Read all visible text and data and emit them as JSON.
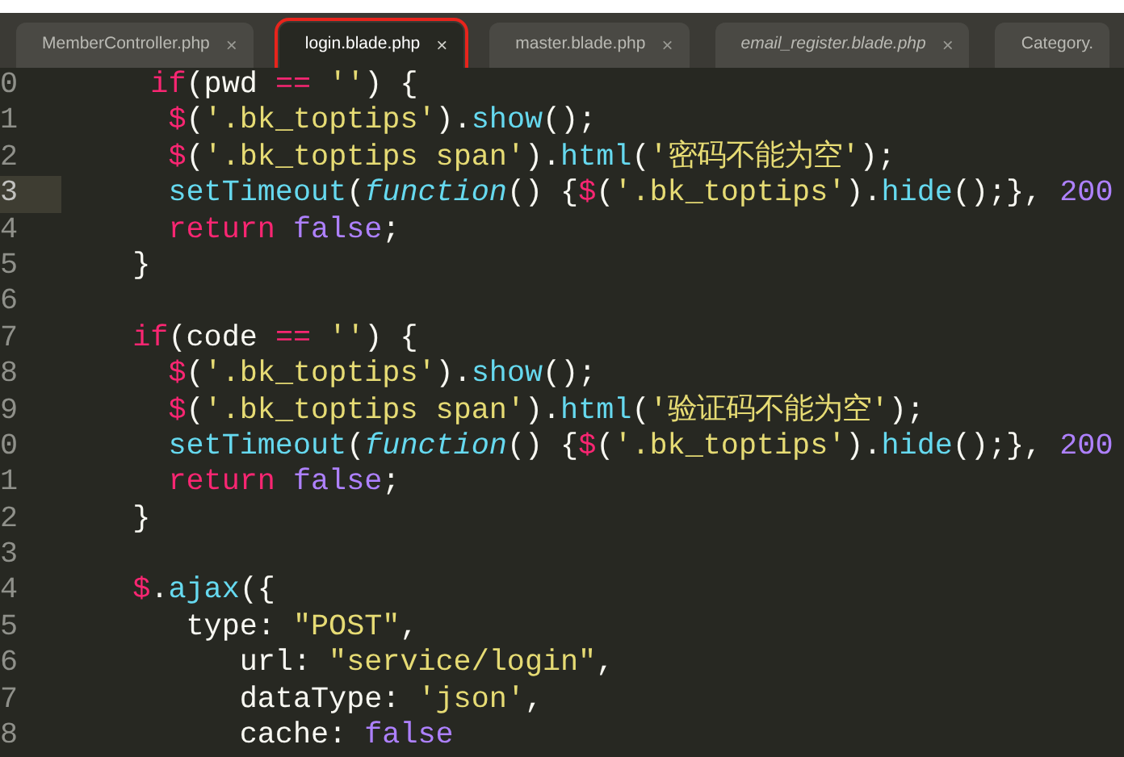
{
  "tabs": [
    {
      "label": "MemberController.php",
      "selected": false,
      "preview": false,
      "outlined": false,
      "closable": true
    },
    {
      "label": "login.blade.php",
      "selected": true,
      "preview": false,
      "outlined": true,
      "closable": true
    },
    {
      "label": "master.blade.php",
      "selected": false,
      "preview": false,
      "outlined": false,
      "closable": true
    },
    {
      "label": "email_register.blade.php",
      "selected": false,
      "preview": true,
      "outlined": false,
      "closable": true
    },
    {
      "label": "Category.",
      "selected": false,
      "preview": false,
      "outlined": false,
      "closable": false
    }
  ],
  "close_glyph": "×",
  "lines": [
    {
      "number": "0",
      "current": false,
      "tokens": [
        {
          "kind": "keyword",
          "text": "     if"
        },
        {
          "kind": "plain",
          "text": "(pwd "
        },
        {
          "kind": "keyword",
          "text": "=="
        },
        {
          "kind": "string",
          "text": " ''"
        },
        {
          "kind": "plain",
          "text": ") {"
        }
      ]
    },
    {
      "number": "1",
      "current": false,
      "tokens": [
        {
          "kind": "keyword",
          "text": "      $"
        },
        {
          "kind": "plain",
          "text": "("
        },
        {
          "kind": "string",
          "text": "'.bk_toptips'"
        },
        {
          "kind": "plain",
          "text": ")."
        },
        {
          "kind": "function",
          "text": "show"
        },
        {
          "kind": "plain",
          "text": "();"
        }
      ]
    },
    {
      "number": "2",
      "current": false,
      "tokens": [
        {
          "kind": "keyword",
          "text": "      $"
        },
        {
          "kind": "plain",
          "text": "("
        },
        {
          "kind": "string",
          "text": "'.bk_toptips span'"
        },
        {
          "kind": "plain",
          "text": ")."
        },
        {
          "kind": "function",
          "text": "html"
        },
        {
          "kind": "plain",
          "text": "("
        },
        {
          "kind": "string",
          "text": "'密码不能为空'"
        },
        {
          "kind": "plain",
          "text": ");"
        }
      ]
    },
    {
      "number": "3",
      "current": true,
      "tokens": [
        {
          "kind": "function",
          "text": "      setTimeout"
        },
        {
          "kind": "plain",
          "text": "("
        },
        {
          "kind": "storage",
          "text": "function"
        },
        {
          "kind": "plain",
          "text": "() {"
        },
        {
          "kind": "keyword",
          "text": "$"
        },
        {
          "kind": "plain",
          "text": "("
        },
        {
          "kind": "string",
          "text": "'.bk_toptips'"
        },
        {
          "kind": "plain",
          "text": ")."
        },
        {
          "kind": "function",
          "text": "hide"
        },
        {
          "kind": "plain",
          "text": "();}, "
        },
        {
          "kind": "constant",
          "text": "200"
        }
      ]
    },
    {
      "number": "4",
      "current": false,
      "tokens": [
        {
          "kind": "keyword",
          "text": "      return"
        },
        {
          "kind": "constant",
          "text": " false"
        },
        {
          "kind": "plain",
          "text": ";"
        }
      ]
    },
    {
      "number": "5",
      "current": false,
      "tokens": [
        {
          "kind": "plain",
          "text": "    }"
        }
      ]
    },
    {
      "number": "6",
      "current": false
    },
    {
      "number": "7",
      "current": false,
      "tokens": [
        {
          "kind": "keyword",
          "text": "    if"
        },
        {
          "kind": "plain",
          "text": "(code "
        },
        {
          "kind": "keyword",
          "text": "=="
        },
        {
          "kind": "string",
          "text": " ''"
        },
        {
          "kind": "plain",
          "text": ") {"
        }
      ]
    },
    {
      "number": "8",
      "current": false,
      "tokens": [
        {
          "kind": "keyword",
          "text": "      $"
        },
        {
          "kind": "plain",
          "text": "("
        },
        {
          "kind": "string",
          "text": "'.bk_toptips'"
        },
        {
          "kind": "plain",
          "text": ")."
        },
        {
          "kind": "function",
          "text": "show"
        },
        {
          "kind": "plain",
          "text": "();"
        }
      ]
    },
    {
      "number": "9",
      "current": false,
      "tokens": [
        {
          "kind": "keyword",
          "text": "      $"
        },
        {
          "kind": "plain",
          "text": "("
        },
        {
          "kind": "string",
          "text": "'.bk_toptips span'"
        },
        {
          "kind": "plain",
          "text": ")."
        },
        {
          "kind": "function",
          "text": "html"
        },
        {
          "kind": "plain",
          "text": "("
        },
        {
          "kind": "string",
          "text": "'验证码不能为空'"
        },
        {
          "kind": "plain",
          "text": ");"
        }
      ]
    },
    {
      "number": "0",
      "current": false,
      "tokens": [
        {
          "kind": "function",
          "text": "      setTimeout"
        },
        {
          "kind": "plain",
          "text": "("
        },
        {
          "kind": "storage",
          "text": "function"
        },
        {
          "kind": "plain",
          "text": "() {"
        },
        {
          "kind": "keyword",
          "text": "$"
        },
        {
          "kind": "plain",
          "text": "("
        },
        {
          "kind": "string",
          "text": "'.bk_toptips'"
        },
        {
          "kind": "plain",
          "text": ")."
        },
        {
          "kind": "function",
          "text": "hide"
        },
        {
          "kind": "plain",
          "text": "();}, "
        },
        {
          "kind": "constant",
          "text": "200"
        }
      ]
    },
    {
      "number": "1",
      "current": false,
      "tokens": [
        {
          "kind": "keyword",
          "text": "      return"
        },
        {
          "kind": "constant",
          "text": " false"
        },
        {
          "kind": "plain",
          "text": ";"
        }
      ]
    },
    {
      "number": "2",
      "current": false,
      "tokens": [
        {
          "kind": "plain",
          "text": "    }"
        }
      ]
    },
    {
      "number": "3",
      "current": false
    },
    {
      "number": "4",
      "current": false,
      "tokens": [
        {
          "kind": "keyword",
          "text": "    $"
        },
        {
          "kind": "plain",
          "text": "."
        },
        {
          "kind": "function",
          "text": "ajax"
        },
        {
          "kind": "plain",
          "text": "({"
        }
      ]
    },
    {
      "number": "5",
      "current": false,
      "tokens": [
        {
          "kind": "plain",
          "text": "       type: "
        },
        {
          "kind": "string",
          "text": "\"POST\""
        },
        {
          "kind": "plain",
          "text": ","
        }
      ]
    },
    {
      "number": "6",
      "current": false,
      "tokens": [
        {
          "kind": "plain",
          "text": "          url: "
        },
        {
          "kind": "string",
          "text": "\"service/login\""
        },
        {
          "kind": "plain",
          "text": ","
        }
      ]
    },
    {
      "number": "7",
      "current": false,
      "tokens": [
        {
          "kind": "plain",
          "text": "          dataType: "
        },
        {
          "kind": "string",
          "text": "'json'"
        },
        {
          "kind": "plain",
          "text": ","
        }
      ]
    },
    {
      "number": "8",
      "current": false,
      "tokens": [
        {
          "kind": "plain",
          "text": "          cache: "
        },
        {
          "kind": "constant",
          "text": "false"
        }
      ]
    }
  ]
}
